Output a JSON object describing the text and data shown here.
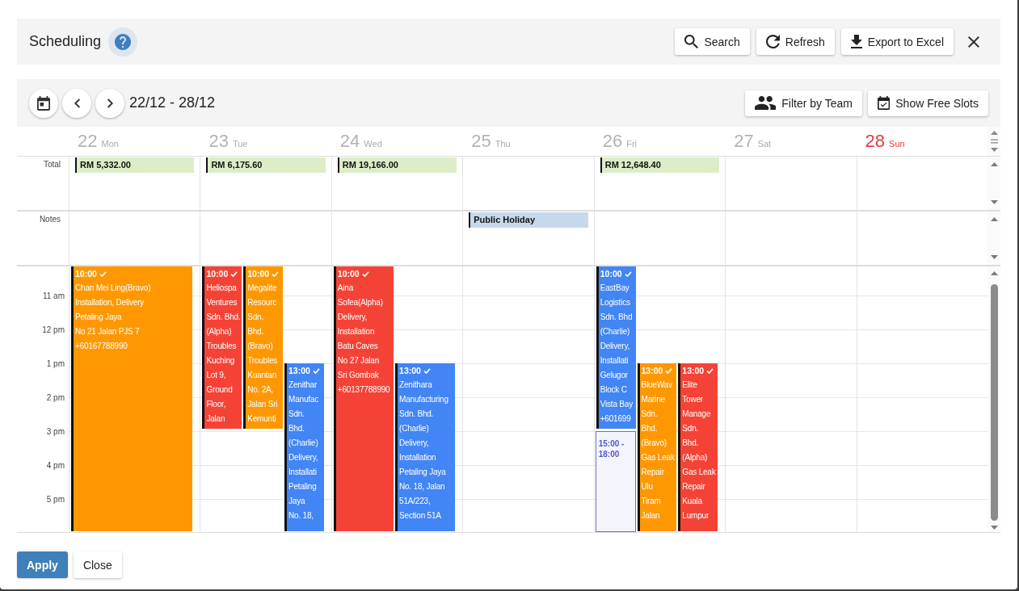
{
  "header": {
    "title": "Scheduling",
    "buttons": [
      "Search",
      "Refresh",
      "Export to Excel"
    ]
  },
  "toolbar": {
    "date_range": "22/12 - 28/12",
    "buttons": [
      "Filter by Team",
      "Show Free Slots"
    ]
  },
  "calendar": {
    "total_label": "Total",
    "notes_label": "Notes",
    "time_labels": [
      "11 am",
      "12 pm",
      "1 pm",
      "2 pm",
      "3 pm",
      "4 pm",
      "5 pm"
    ],
    "days": [
      {
        "date": "22",
        "weekday": "Mon",
        "sunday": false,
        "total": "RM 5,332.00",
        "events": [
          {
            "start": "10:00",
            "continues_below": true,
            "confirmed": true,
            "color": "#ff9800",
            "lines": [
              "Chan Mei Ling(Bravo)",
              "Installation, Delivery",
              "Petaling Jaya",
              "No 21 Jalan PJS 7",
              "+60167788990"
            ]
          }
        ]
      },
      {
        "date": "23",
        "weekday": "Tue",
        "sunday": false,
        "total": "RM 6,175.60",
        "events": [
          {
            "start": "10:00",
            "continues_below": false,
            "confirmed": true,
            "color": "#f44336",
            "lines": [
              "Heliospa",
              "Ventures",
              "Sdn. Bhd.",
              "(Alpha)",
              "Troubles",
              "Kuching",
              "Lot 9,",
              "Ground",
              "Floor,",
              "Jalan"
            ]
          },
          {
            "start": "10:00",
            "continues_below": false,
            "confirmed": true,
            "color": "#ff9800",
            "lines": [
              "Megalite",
              "Resourc",
              "Sdn.",
              "Bhd.",
              "(Bravo)",
              "Troubles",
              "Kuantan",
              "No. 2A,",
              "Jalan Sri",
              "Kemunti"
            ]
          },
          {
            "start": "13:00",
            "continues_below": true,
            "confirmed": true,
            "color": "#4285f4",
            "lines": [
              "Zenithar",
              "Manufac",
              "Sdn.",
              "Bhd.",
              "(Charlie)",
              "Delivery,",
              "Installati",
              "Petaling",
              "Jaya",
              "No. 18,"
            ]
          }
        ]
      },
      {
        "date": "24",
        "weekday": "Wed",
        "sunday": false,
        "total": "RM 19,166.00",
        "events": [
          {
            "start": "10:00",
            "continues_below": true,
            "confirmed": true,
            "color": "#f44336",
            "lines": [
              "Aina",
              "Sofea(Alpha)",
              "Delivery,",
              "Installation",
              "Batu Caves",
              "No 27 Jalan",
              "Sri Gombak",
              "+60137788990"
            ]
          },
          {
            "start": "13:00",
            "continues_below": true,
            "confirmed": true,
            "color": "#4285f4",
            "lines": [
              "Zenithara",
              "Manufacturing",
              "Sdn. Bhd.",
              "(Charlie)",
              "Delivery,",
              "Installation",
              "Petaling Jaya",
              "No. 18, Jalan",
              "51A/223,",
              "Section 51A"
            ]
          }
        ]
      },
      {
        "date": "25",
        "weekday": "Thu",
        "sunday": false,
        "note": "Public Holiday"
      },
      {
        "date": "26",
        "weekday": "Fri",
        "sunday": false,
        "total": "RM 12,648.40",
        "events": [
          {
            "start": "10:00",
            "continues_below": false,
            "confirmed": true,
            "color": "#4285f4",
            "lines": [
              "EastBay",
              "Logistics",
              "Sdn. Bhd",
              "(Charlie)",
              "Delivery,",
              "Installati",
              "Gelugor",
              "Block C",
              "Vista Bay",
              "+601699"
            ]
          },
          {
            "start": "13:00",
            "continues_below": true,
            "confirmed": true,
            "color": "#ff9800",
            "lines": [
              "BlueWav",
              "Marine",
              "Sdn.",
              "Bhd.",
              "(Bravo)",
              "Gas Leak",
              "Repair",
              "Ulu",
              "Tiram",
              "Jalan"
            ]
          },
          {
            "start": "13:00",
            "continues_below": true,
            "confirmed": true,
            "color": "#f44336",
            "lines": [
              "Elite",
              "Tower",
              "Manage",
              "Sdn.",
              "Bhd.",
              "(Alpha)",
              "Gas Leak",
              "Repair",
              "Kuala",
              "Lumpur"
            ]
          }
        ],
        "free_slot": {
          "label": "15:00 - 18:00"
        }
      },
      {
        "date": "27",
        "weekday": "Sat",
        "sunday": false
      },
      {
        "date": "28",
        "weekday": "Sun",
        "sunday": true
      }
    ]
  },
  "footer": {
    "buttons": [
      {
        "kind": "primary",
        "label": "Apply"
      },
      {
        "kind": "secondary",
        "label": "Close"
      }
    ]
  }
}
